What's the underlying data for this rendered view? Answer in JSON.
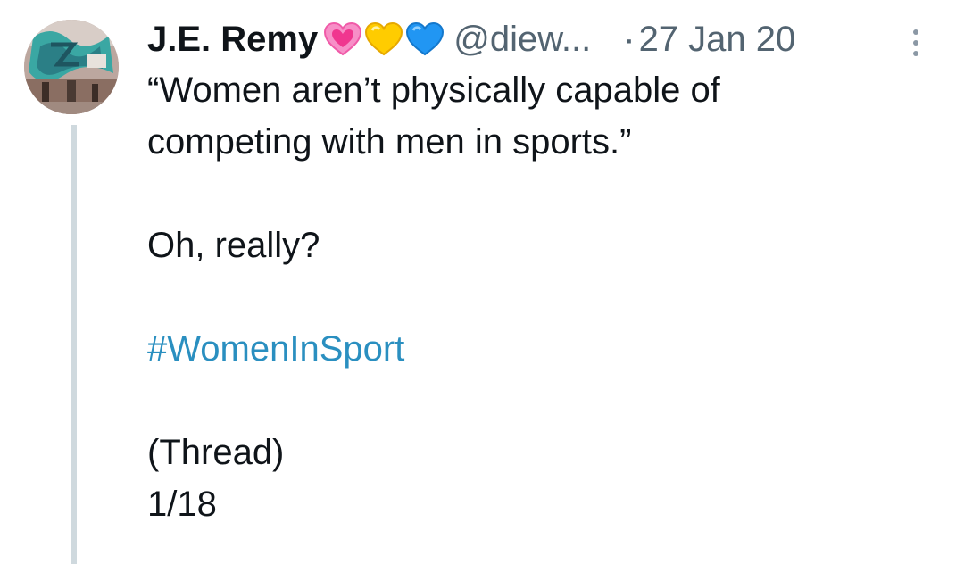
{
  "author": {
    "name": "J.E. Remy",
    "handle": "@diew...",
    "separator": "·",
    "date": "27 Jan 20",
    "badges": [
      "pink-heart-icon",
      "yellow-heart-icon",
      "blue-heart-icon"
    ]
  },
  "tweet": {
    "line1": "“Women aren’t physically capable of",
    "line2": "competing with men in sports.”",
    "line3": "Oh, really?",
    "hashtag": "#WomenInSport",
    "line5": "(Thread)",
    "line6": "1/18"
  },
  "colors": {
    "text": "#0f1419",
    "muted": "#536471",
    "link": "#2a8fc0",
    "thread_line": "#cfd9de"
  }
}
